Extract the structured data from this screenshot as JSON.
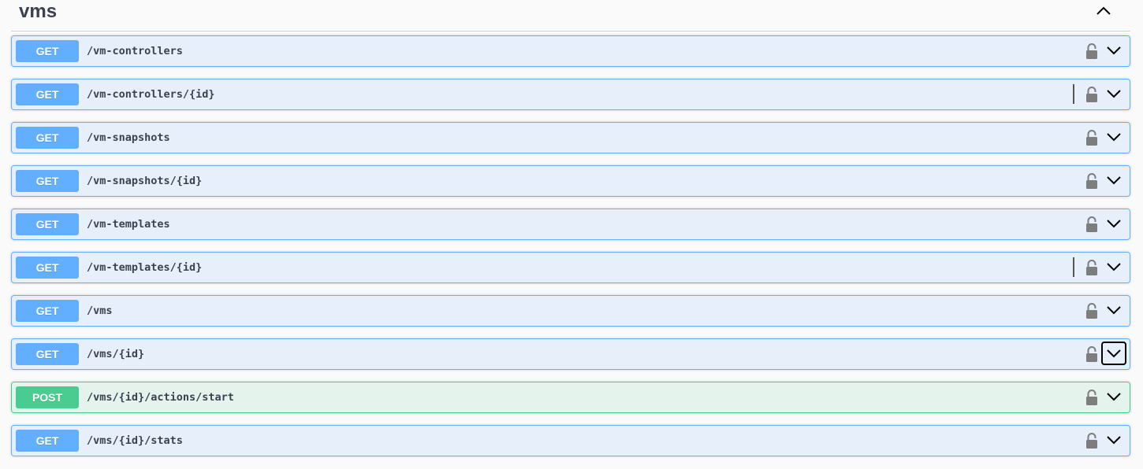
{
  "section": {
    "title": "vms",
    "collapse_icon": "chevron-up-icon"
  },
  "operations": [
    {
      "method": "GET",
      "path": "/vm-controllers",
      "divider": false,
      "focused": false
    },
    {
      "method": "GET",
      "path": "/vm-controllers/{id}",
      "divider": true,
      "focused": false
    },
    {
      "method": "GET",
      "path": "/vm-snapshots",
      "divider": false,
      "focused": false
    },
    {
      "method": "GET",
      "path": "/vm-snapshots/{id}",
      "divider": false,
      "focused": false
    },
    {
      "method": "GET",
      "path": "/vm-templates",
      "divider": false,
      "focused": false
    },
    {
      "method": "GET",
      "path": "/vm-templates/{id}",
      "divider": true,
      "focused": false
    },
    {
      "method": "GET",
      "path": "/vms",
      "divider": false,
      "focused": false
    },
    {
      "method": "GET",
      "path": "/vms/{id}",
      "divider": false,
      "focused": true
    },
    {
      "method": "POST",
      "path": "/vms/{id}/actions/start",
      "divider": false,
      "focused": false
    },
    {
      "method": "GET",
      "path": "/vms/{id}/stats",
      "divider": false,
      "focused": false
    }
  ],
  "colors": {
    "get": "#61affe",
    "post": "#49cc90",
    "text": "#3b4151",
    "lock": "#7d7d7d"
  },
  "icons": {
    "lock": "lock-icon",
    "expand": "chevron-down-icon"
  }
}
